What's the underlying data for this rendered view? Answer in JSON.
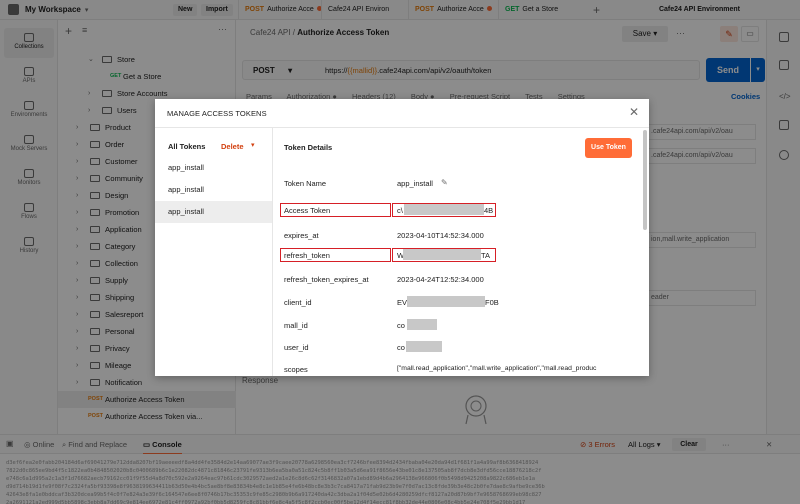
{
  "topbar": {
    "workspace": "My Workspace",
    "new_label": "New",
    "import_label": "Import",
    "tabs": [
      {
        "method": "POST",
        "label": "Authorize Acce",
        "dirty": true
      },
      {
        "method": "",
        "label": "Cafe24 API Environ",
        "dirty": false
      },
      {
        "method": "POST",
        "label": "Authorize Acce",
        "dirty": true
      },
      {
        "method": "GET",
        "label": "Get a Store",
        "dirty": false
      }
    ],
    "environment": "Cafe24 API Environment"
  },
  "rail": {
    "items": [
      "Collections",
      "APIs",
      "Environments",
      "Mock Servers",
      "Monitors",
      "Flows",
      "History"
    ]
  },
  "sidebar": {
    "tree": [
      {
        "type": "folder",
        "label": "Store",
        "open": true,
        "indent": 1
      },
      {
        "type": "request",
        "method": "GET",
        "label": "Get a Store",
        "indent": 2
      },
      {
        "type": "folder",
        "label": "Store Accounts",
        "open": false,
        "indent": 1
      },
      {
        "type": "folder",
        "label": "Users",
        "open": false,
        "indent": 1
      },
      {
        "type": "folder",
        "label": "Product",
        "open": false,
        "indent": 0
      },
      {
        "type": "folder",
        "label": "Order",
        "open": false,
        "indent": 0
      },
      {
        "type": "folder",
        "label": "Customer",
        "open": false,
        "indent": 0
      },
      {
        "type": "folder",
        "label": "Community",
        "open": false,
        "indent": 0
      },
      {
        "type": "folder",
        "label": "Design",
        "open": false,
        "indent": 0
      },
      {
        "type": "folder",
        "label": "Promotion",
        "open": false,
        "indent": 0
      },
      {
        "type": "folder",
        "label": "Application",
        "open": false,
        "indent": 0
      },
      {
        "type": "folder",
        "label": "Category",
        "open": false,
        "indent": 0
      },
      {
        "type": "folder",
        "label": "Collection",
        "open": false,
        "indent": 0
      },
      {
        "type": "folder",
        "label": "Supply",
        "open": false,
        "indent": 0
      },
      {
        "type": "folder",
        "label": "Shipping",
        "open": false,
        "indent": 0
      },
      {
        "type": "folder",
        "label": "Salesreport",
        "open": false,
        "indent": 0
      },
      {
        "type": "folder",
        "label": "Personal",
        "open": false,
        "indent": 0
      },
      {
        "type": "folder",
        "label": "Privacy",
        "open": false,
        "indent": 0
      },
      {
        "type": "folder",
        "label": "Mileage",
        "open": false,
        "indent": 0
      },
      {
        "type": "folder",
        "label": "Notification",
        "open": false,
        "indent": 0
      },
      {
        "type": "request",
        "method": "POST",
        "label": "Authorize Access Token",
        "indent": -1,
        "selected": true
      },
      {
        "type": "request",
        "method": "POST",
        "label": "Authorize Access Token via...",
        "indent": -1
      }
    ]
  },
  "main": {
    "crumb_parent": "Cafe24 API",
    "crumb_sep": "/",
    "crumb_title": "Authorize Access Token",
    "save_label": "Save",
    "method": "POST",
    "url_prefix": "https://",
    "url_var": "{{mallid}}",
    "url_rest": ".cafe24api.com/api/v2/oauth/token",
    "send_label": "Send",
    "req_tabs": [
      "Params",
      "Authorization ●",
      "Headers (12)",
      "Body ●",
      "Pre-request Script",
      "Tests",
      "Settings"
    ],
    "cookies_label": "Cookies",
    "response_label": "Response",
    "bg_values": [
      ".cafe24api.com/api/v2/oau",
      ".cafe24api.com/api/v2/oau",
      "",
      "ion,mall.write_application",
      "eader",
      ""
    ]
  },
  "modal": {
    "title": "MANAGE ACCESS TOKENS",
    "all_tokens_label": "All Tokens",
    "delete_label": "Delete",
    "tokens": [
      "app_install",
      "app_install",
      "app_install"
    ],
    "selected_index": 2,
    "details_title": "Token Details",
    "use_token_label": "Use Token",
    "fields": [
      {
        "key": "Token Name",
        "value": "app_install",
        "editable": true
      },
      {
        "key": "Access Token",
        "value_start": "c\\",
        "value_end": "4B",
        "highlight": true
      },
      {
        "key": "expires_at",
        "value": "2023-04-10T14:52:34.000"
      },
      {
        "key": "refresh_token",
        "value_start": "W",
        "value_end": "TA",
        "highlight": true
      },
      {
        "key": "refresh_token_expires_at",
        "value": "2023-04-24T12:52:34.000"
      },
      {
        "key": "client_id",
        "value_start": "EV",
        "value_end": "F0B"
      },
      {
        "key": "mall_id",
        "value_start": "co",
        "value_end": ""
      },
      {
        "key": "user_id",
        "value_start": "co",
        "value_end": ""
      },
      {
        "key": "scopes",
        "value": "[\"mall.read_application\",\"mall.write_application\",\"mall.read_produc"
      }
    ]
  },
  "console": {
    "online_label": "Online",
    "find_label": "Find and Replace",
    "console_label": "Console",
    "errors_label": "3 Errors",
    "logs_label": "All Logs",
    "clear_label": "Clear",
    "lines": [
      "d3ef6fea2e0fabb204184d6af69041279e712dda8207bf19aeeeedf8a4dd4fe3584d2e14aa69077ae3f9caee20778a6298560ea3cf7246bfee8394d2434fbaba04e20da94d1f681f1a4a99af8b6368418924",
      "7822d0c865ee9bd4f5c1822ea0b4848502020b8c0400689b6c1e22082dc4871c81846c23791fe9313b6ea5ba0a51c824c5b8ff1b03a5d6ea91f8656e43be01c8e137505ab8f7dcb8e3dfd56cce18876218c2f",
      "e748c6a1d995a2c1a3f1d76682aecb79162cc01f9f55d4a8d70c592e2a9264eac97b61cdc3029572aed2a1e26c8d6c62f3146832a07a1ebd89d4b6a2964138e966806f0b5498d9425208a9822c686eb1e1a",
      "d9d714b19d1fe9f08f7c2324fa5bf93398e8f9638199634411b63d50e4b4bc5ae8bf8e83834b4e8c1e1b85e4fe6b48bc8e3b3c7ca8417a71fab9d23b9e7f0d7ac13c8fde39b3e48c2b0fe7dae8c9afbe9ce36b",
      "42643e8fa1e0bddcaf3b320dcea99b5f4c0f7e824a3e39f6c164547e6ee8f0746b17bc35353c9fe85c2980b9b6a917240da42c3dba2a1f04d5e02b6d4280259dfcf8127a20d87b9bf7e9658768699eb98c827",
      "2a2691121a2ed999d5bb5898c3ebb8a7dd69c9e814ee6972e81c4ff0972a92bf0bb5d8259fc8c81bbf6e8c4a5f5c8f2ccb0ec00f5be12d4f14ecc81f8bb32de44e0806e08c4bb5e24e708f5e29bb1d17"
    ]
  }
}
